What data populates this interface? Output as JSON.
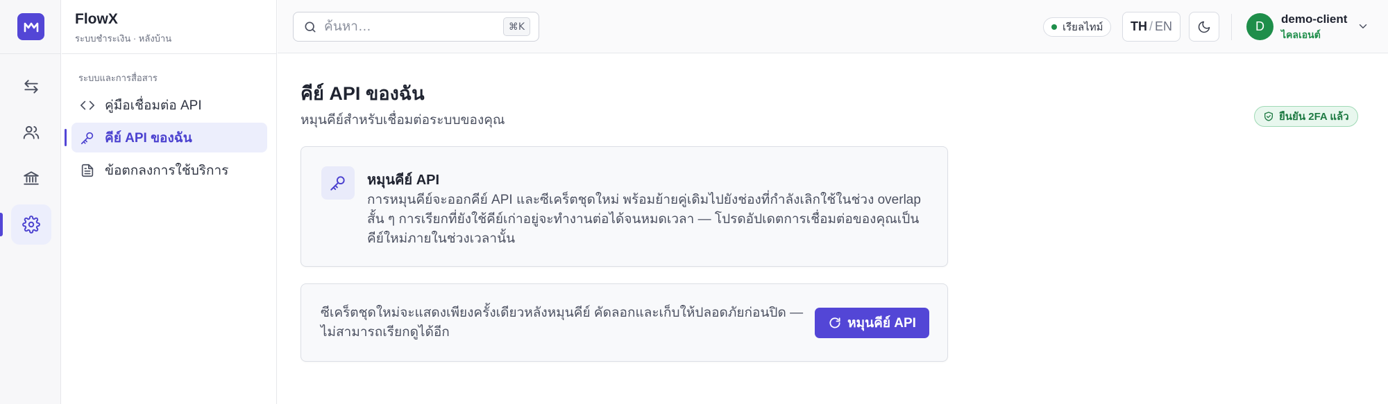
{
  "app": {
    "name": "FlowX",
    "subtitle": "ระบบชำระเงิน · หลังบ้าน",
    "accent": "#5346d6"
  },
  "rail": {
    "items": [
      {
        "icon": "arrows-exchange-icon",
        "active": false
      },
      {
        "icon": "users-icon",
        "active": false
      },
      {
        "icon": "bank-icon",
        "active": false
      },
      {
        "icon": "gear-icon",
        "active": true
      }
    ]
  },
  "sidebar": {
    "section_title": "ระบบและการสื่อสาร",
    "items": [
      {
        "label": "คู่มือเชื่อมต่อ API",
        "icon": "code-icon",
        "active": false
      },
      {
        "label": "คีย์ API ของฉัน",
        "icon": "key-icon",
        "active": true
      },
      {
        "label": "ข้อตกลงการใช้บริการ",
        "icon": "document-icon",
        "active": false
      }
    ]
  },
  "topbar": {
    "search_placeholder": "ค้นหา…",
    "search_shortcut": "⌘K",
    "live_label": "เรียลไทม์",
    "lang_active": "TH",
    "lang_separator": "/",
    "lang_inactive": "EN",
    "user": {
      "initial": "D",
      "name": "demo-client",
      "role": "ไคลเอนต์"
    }
  },
  "main": {
    "title": "คีย์ API ของฉัน",
    "subtitle": "หมุนคีย์สำหรับเชื่อมต่อระบบของคุณ",
    "verified_badge": "ยืนยัน 2FA แล้ว",
    "info_card": {
      "title": "หมุนคีย์ API",
      "body": "การหมุนคีย์จะออกคีย์ API และซีเคร็ตชุดใหม่ พร้อมย้ายคู่เดิมไปยังช่องที่กำลังเลิกใช้ในช่วง overlap สั้น ๆ การเรียกที่ยังใช้คีย์เก่าอยู่จะทำงานต่อได้จนหมดเวลา — โปรดอัปเดตการเชื่อมต่อของคุณเป็นคีย์ใหม่ภายในช่วงเวลานั้น"
    },
    "action_card": {
      "text": "ซีเคร็ตชุดใหม่จะแสดงเพียงครั้งเดียวหลังหมุนคีย์ คัดลอกและเก็บให้ปลอดภัยก่อนปิด — ไม่สามารถเรียกดูได้อีก",
      "button_label": "หมุนคีย์ API"
    }
  }
}
